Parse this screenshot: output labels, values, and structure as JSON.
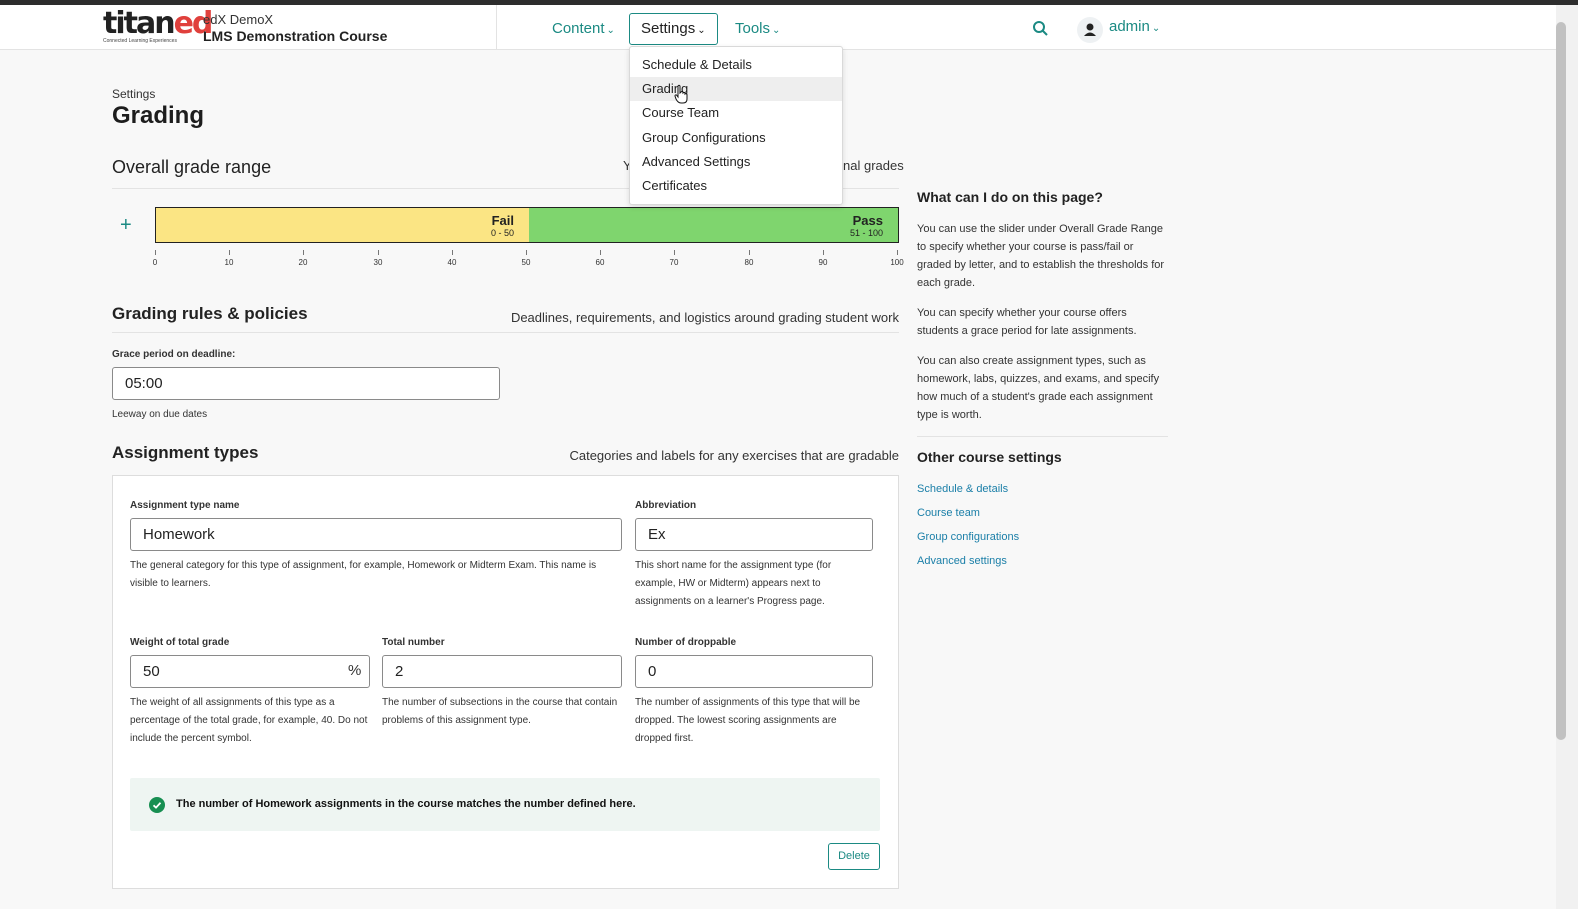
{
  "header": {
    "logo_main": "titan",
    "logo_accent": "ed",
    "logo_tagline": "Connected Learning Experiences",
    "course_org": "edX DemoX",
    "course_title": "LMS Demonstration Course",
    "nav": {
      "content": "Content",
      "settings": "Settings",
      "tools": "Tools"
    },
    "user": "admin",
    "accent_color": "#1b8a83"
  },
  "settings_menu": {
    "items": [
      {
        "label": "Schedule & Details"
      },
      {
        "label": "Grading"
      },
      {
        "label": "Course Team"
      },
      {
        "label": "Group Configurations"
      },
      {
        "label": "Advanced Settings"
      },
      {
        "label": "Certificates"
      }
    ],
    "hovered": "Grading"
  },
  "page": {
    "breadcrumb": "Settings",
    "title": "Grading"
  },
  "grade_range": {
    "title": "Overall grade range",
    "desc_prefix": "Y",
    "desc_suffix": "nal grades",
    "segments": [
      {
        "label": "Fail",
        "range": "0 - 50",
        "min": 0,
        "max": 50,
        "color": "#fbe584"
      },
      {
        "label": "Pass",
        "range": "51 - 100",
        "min": 51,
        "max": 100,
        "color": "#7fd56e"
      }
    ],
    "ticks": [
      "0",
      "10",
      "20",
      "30",
      "40",
      "50",
      "60",
      "70",
      "80",
      "90",
      "100"
    ]
  },
  "grading_rules": {
    "title": "Grading rules & policies",
    "desc": "Deadlines, requirements, and logistics around grading student work",
    "grace_label": "Grace period on deadline:",
    "grace_value": "05:00",
    "grace_help": "Leeway on due dates"
  },
  "assignment_types": {
    "title": "Assignment types",
    "desc": "Categories and labels for any exercises that are gradable",
    "name_label": "Assignment type name",
    "name_value": "Homework",
    "name_help": "The general category for this type of assignment, for example, Homework or Midterm Exam. This name is visible to learners.",
    "abbr_label": "Abbreviation",
    "abbr_value": "Ex",
    "abbr_help": "This short name for the assignment type (for example, HW or Midterm) appears next to assignments on a learner's Progress page.",
    "weight_label": "Weight of total grade",
    "weight_value": "50",
    "weight_unit": "%",
    "weight_help": "The weight of all assignments of this type as a percentage of the total grade, for example, 40. Do not include the percent symbol.",
    "total_label": "Total number",
    "total_value": "2",
    "total_help": "The number of subsections in the course that contain problems of this assignment type.",
    "drop_label": "Number of droppable",
    "drop_value": "0",
    "drop_help": "The number of assignments of this type that will be dropped. The lowest scoring assignments are dropped first.",
    "notice": "The number of Homework assignments in the course matches the number defined here.",
    "delete_label": "Delete"
  },
  "aside": {
    "help_title": "What can I do on this page?",
    "p1": "You can use the slider under Overall Grade Range to specify whether your course is pass/fail or graded by letter, and to establish the thresholds for each grade.",
    "p2": "You can specify whether your course offers students a grace period for late assignments.",
    "p3": "You can also create assignment types, such as homework, labs, quizzes, and exams, and specify how much of a student's grade each assignment type is worth.",
    "other_title": "Other course settings",
    "links": [
      "Schedule & details",
      "Course team",
      "Group configurations",
      "Advanced settings"
    ]
  }
}
